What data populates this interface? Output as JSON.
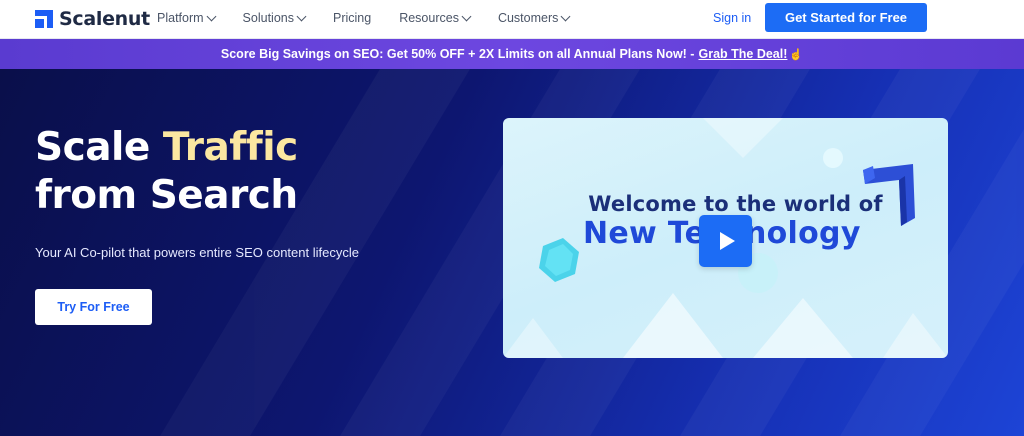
{
  "header": {
    "logo_text": "Scalenut",
    "nav": [
      {
        "label": "Platform",
        "dropdown": true
      },
      {
        "label": "Solutions",
        "dropdown": true
      },
      {
        "label": "Pricing",
        "dropdown": false
      },
      {
        "label": "Resources",
        "dropdown": true
      },
      {
        "label": "Customers",
        "dropdown": true
      }
    ],
    "signin_label": "Sign in",
    "cta_label": "Get Started for Free"
  },
  "promo": {
    "text": "Score Big Savings on SEO: Get 50% OFF + 2X Limits on all Annual Plans Now! -",
    "link_label": "Grab The Deal!",
    "icon": "pointer-hand-icon"
  },
  "hero": {
    "title_part1": "Scale",
    "title_highlight": "Traffic",
    "title_line2": "from Search",
    "subtitle": "Your AI Co-pilot that powers entire SEO content lifecycle",
    "button_label": "Try For Free"
  },
  "video": {
    "line1": "Welcome to the world of",
    "line2": "New Technology",
    "play_icon": "play-icon"
  },
  "colors": {
    "brand_blue": "#1c6cf5",
    "promo_purple": "#6d47e0",
    "hero_dark": "#0b1150",
    "highlight_yellow": "#fbe7a1"
  }
}
